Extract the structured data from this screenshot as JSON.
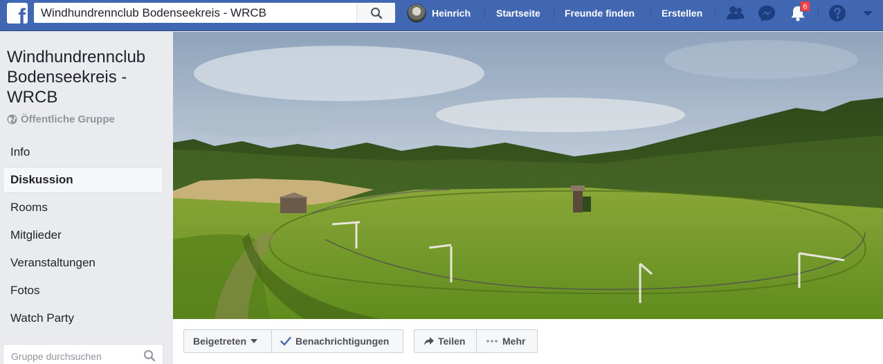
{
  "topbar": {
    "logo_letter": "f",
    "search_value": "Windhundrennclub Bodenseekreis - WRCB",
    "user_name": "Heinrich",
    "nav_home": "Startseite",
    "nav_find_friends": "Freunde finden",
    "nav_create": "Erstellen",
    "notifications_count": "6",
    "icons": [
      "friend-requests-icon",
      "messenger-icon",
      "notifications-icon",
      "help-icon",
      "dropdown-arrow-icon"
    ]
  },
  "group": {
    "title": "Windhundrennclub Bodenseekreis - WRCB",
    "privacy": "Öffentliche Gruppe"
  },
  "sidebar": {
    "items": [
      {
        "label": "Info"
      },
      {
        "label": "Diskussion",
        "active": true
      },
      {
        "label": "Rooms"
      },
      {
        "label": "Mitglieder"
      },
      {
        "label": "Veranstaltungen"
      },
      {
        "label": "Fotos"
      },
      {
        "label": "Watch Party"
      }
    ],
    "search_placeholder": "Gruppe durchsuchen"
  },
  "actions": {
    "joined": "Beigetreten",
    "notifications": "Benachrichtigungen",
    "share": "Teilen",
    "more": "Mehr"
  },
  "colors": {
    "brand": "#4267b2",
    "badge": "#fa3e3e",
    "check": "#4267b2"
  }
}
